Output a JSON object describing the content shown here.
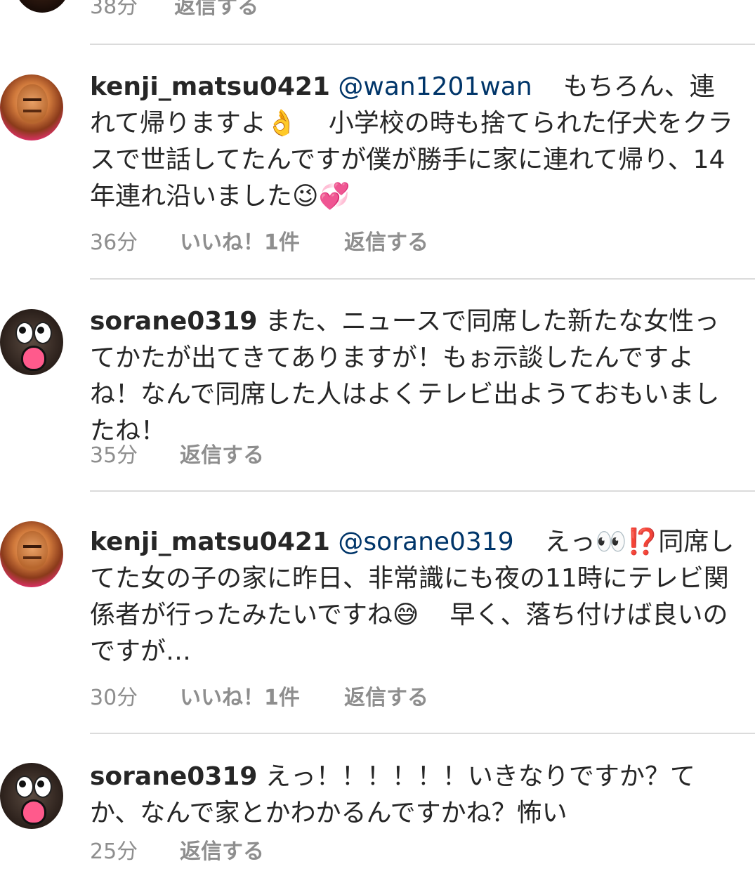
{
  "top_partial": {
    "time": "38分",
    "reply": "返信する"
  },
  "comments": [
    {
      "username": "kenji_matsu0421",
      "mention": "@wan1201wan",
      "text_1": "もちろん、連れて帰りますよ",
      "emoji_1": "👌",
      "text_2": "小学校の時も捨てられた仔犬をクラスで世話してたんですが僕が勝手に家に連れて帰り、14年連れ沿いました",
      "emoji_2": "😉",
      "emoji_3": "💞",
      "time": "36分",
      "likes": "いいね！1件",
      "reply": "返信する"
    },
    {
      "username": "sorane0319",
      "text_1": "また、ニュースで同席した新たな女性ってかたが出てきてありますが！もぉ示談したんですよね！なんで同席した人はよくテレビ出ようておもいましたね！",
      "time": "35分",
      "reply": "返信する"
    },
    {
      "username": "kenji_matsu0421",
      "mention": "@sorane0319",
      "text_1": "えっ",
      "emoji_1": "👀",
      "emoji_2": "⁉️",
      "text_2": "同席してた女の子の家に昨日、非常識にも夜の11時にテレビ関係者が行ったみたいですね",
      "emoji_3": "😅",
      "text_3": "早く、落ち付けば良いのですが…",
      "time": "30分",
      "likes": "いいね！1件",
      "reply": "返信する"
    },
    {
      "username": "sorane0319",
      "text_1": "えっ！！！！！！いきなりですか？てか、なんで家とかわかるんですかね？怖い",
      "time": "25分",
      "reply": "返信する"
    }
  ]
}
